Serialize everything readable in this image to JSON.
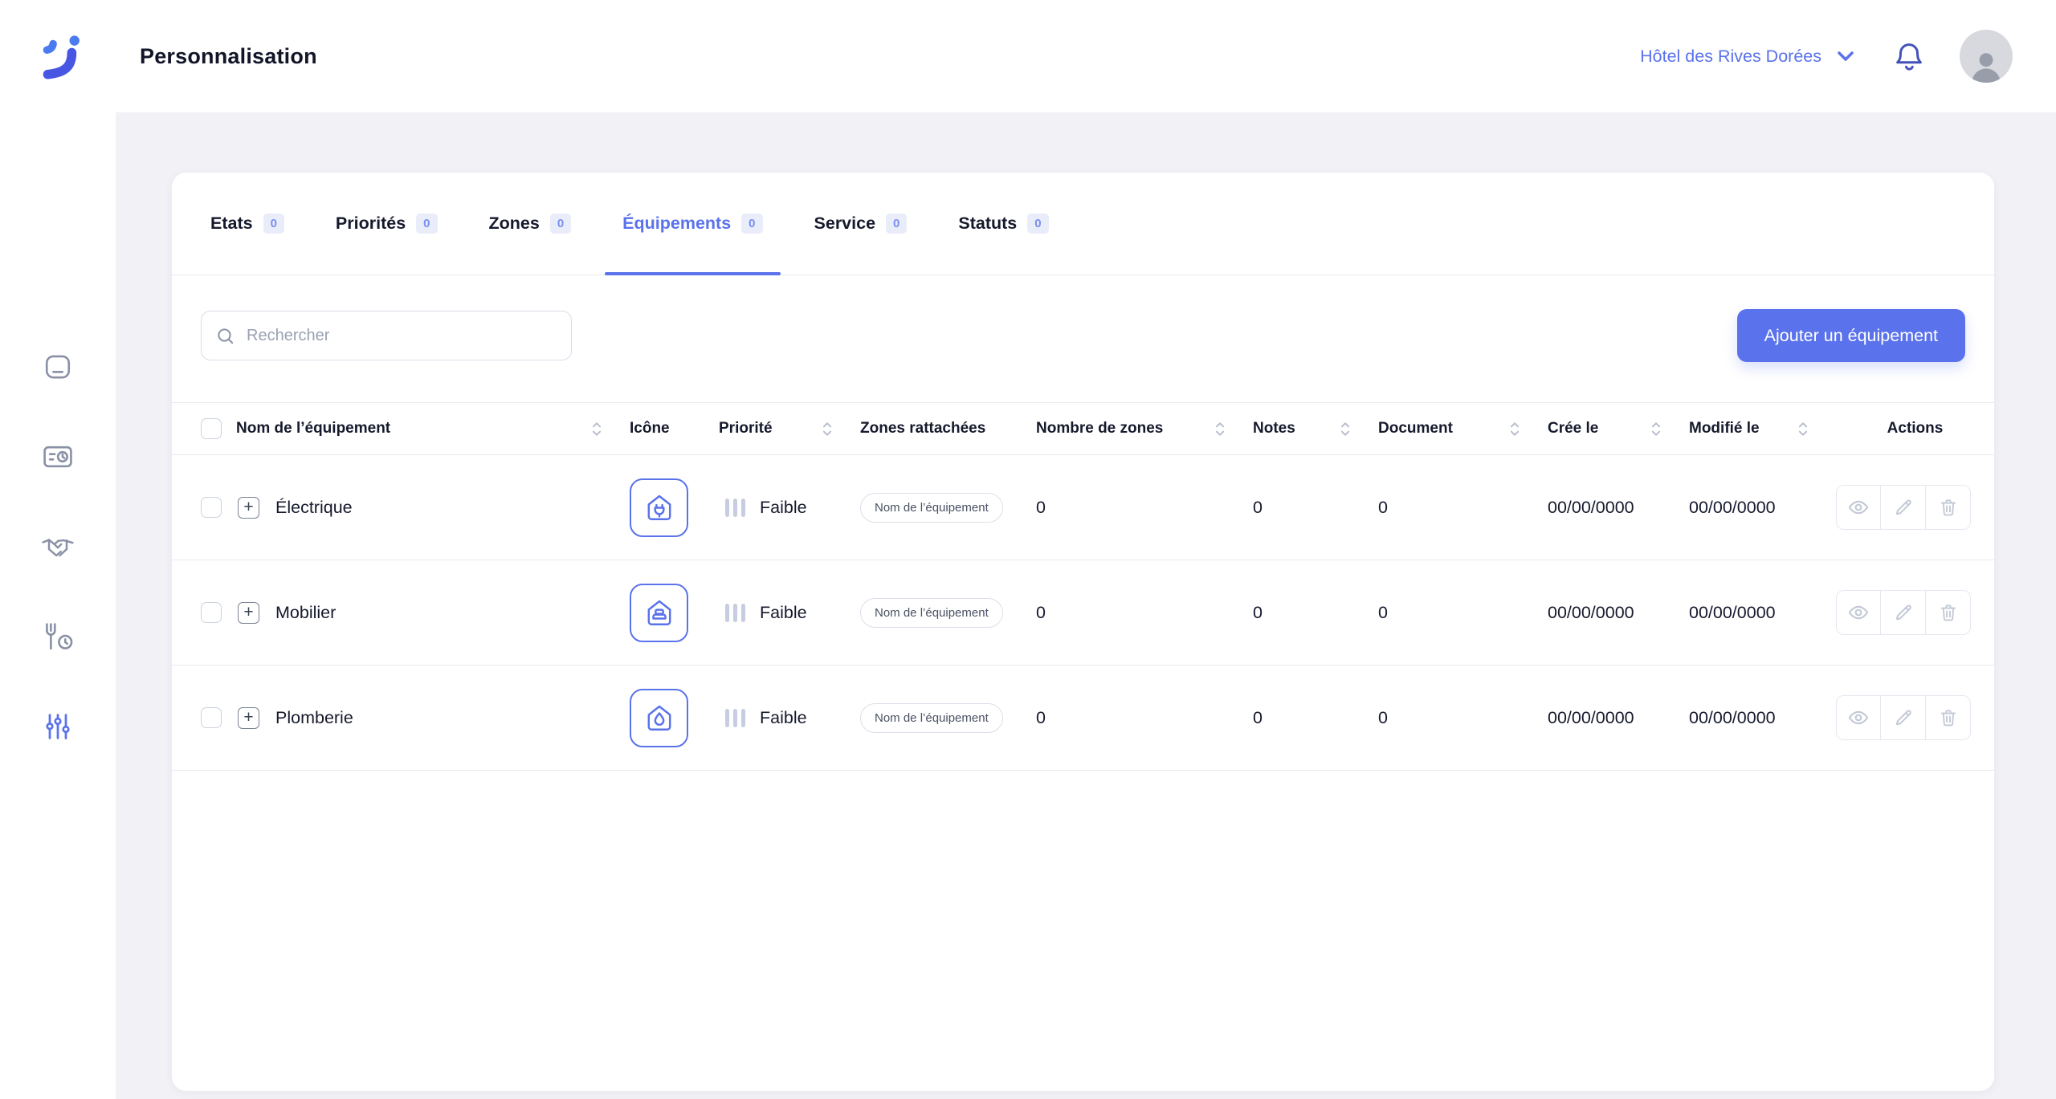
{
  "header": {
    "title": "Personnalisation",
    "hotel_selector": "Hôtel des Rives Dorées"
  },
  "sidebar": {
    "items": [
      {
        "icon": "home-icon",
        "active": false
      },
      {
        "icon": "card-clock-icon",
        "active": false
      },
      {
        "icon": "handshake-icon",
        "active": false
      },
      {
        "icon": "fork-clock-icon",
        "active": false
      },
      {
        "icon": "sliders-icon",
        "active": true
      }
    ]
  },
  "tabs": [
    {
      "label": "Etats",
      "count": "0",
      "active": false
    },
    {
      "label": "Priorités",
      "count": "0",
      "active": false
    },
    {
      "label": "Zones",
      "count": "0",
      "active": false
    },
    {
      "label": "Équipements",
      "count": "0",
      "active": true
    },
    {
      "label": "Service",
      "count": "0",
      "active": false
    },
    {
      "label": "Statuts",
      "count": "0",
      "active": false
    }
  ],
  "toolbar": {
    "search_placeholder": "Rechercher",
    "add_button": "Ajouter un équipement"
  },
  "table": {
    "expand_symbol": "+",
    "columns": [
      {
        "label": "Nom de l’équipement",
        "sortable": true,
        "align": "left"
      },
      {
        "label": "Icône",
        "sortable": false,
        "align": "left"
      },
      {
        "label": "Priorité",
        "sortable": true,
        "align": "left"
      },
      {
        "label": "Zones rattachées",
        "sortable": false,
        "align": "left"
      },
      {
        "label": "Nombre de zones",
        "sortable": true,
        "align": "left"
      },
      {
        "label": "Notes",
        "sortable": true,
        "align": "left"
      },
      {
        "label": "Document",
        "sortable": true,
        "align": "left"
      },
      {
        "label": "Crée le",
        "sortable": true,
        "align": "left"
      },
      {
        "label": "Modifié le",
        "sortable": true,
        "align": "left"
      },
      {
        "label": "Actions",
        "sortable": false,
        "align": "center"
      }
    ],
    "rows": [
      {
        "name": "Électrique",
        "icon": "house-plug",
        "priority": "Faible",
        "zone_badge": "Nom de l’équipement",
        "zones": "0",
        "notes": "0",
        "documents": "0",
        "created": "00/00/0000",
        "modified": "00/00/0000"
      },
      {
        "name": "Mobilier",
        "icon": "house-sofa",
        "priority": "Faible",
        "zone_badge": "Nom de l’équipement",
        "zones": "0",
        "notes": "0",
        "documents": "0",
        "created": "00/00/0000",
        "modified": "00/00/0000"
      },
      {
        "name": "Plomberie",
        "icon": "house-drop",
        "priority": "Faible",
        "zone_badge": "Nom de l’équipement",
        "zones": "0",
        "notes": "0",
        "documents": "0",
        "created": "00/00/0000",
        "modified": "00/00/0000"
      }
    ]
  },
  "colors": {
    "primary": "#5a72eb",
    "primary-soft": "#e9ecf9",
    "page-bg": "#f1f1f6",
    "border": "#e8eaf0",
    "muted": "#9aa1b3",
    "icon-muted": "#c2c8d6",
    "side-icon": "#8a90a5"
  }
}
